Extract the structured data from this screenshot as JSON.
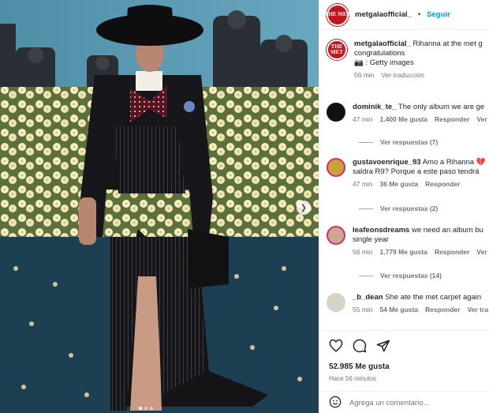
{
  "post": {
    "account": "metgalaofficial_",
    "dot": "•",
    "follow_label": "Seguir",
    "avatar_text": "THE MET"
  },
  "caption": {
    "username": "metgalaofficial_",
    "line1": "Rihanna at the met g",
    "line2": "congratulations",
    "line3": "📷 : Getty images",
    "time": "56 min",
    "translate": "Ver traducción"
  },
  "comments": [
    {
      "username": "dominik_te_",
      "text": "The only album we are ge",
      "line2": "",
      "time": "47 min",
      "likes": "1.400 Me gusta",
      "reply": "Responder",
      "translate": "Ver tr",
      "replies": "Ver respuestas (7)"
    },
    {
      "username": "gustavoenrique_93",
      "text": "Amo a Rihanna 💔",
      "line2": "saldra R9? Porque a este paso tendrá",
      "time": "47 min",
      "likes": "36 Me gusta",
      "reply": "Responder",
      "translate": "",
      "replies": "Ver respuestas (2)"
    },
    {
      "username": "leafeonsdreams",
      "text": "we need an album bu",
      "line2": "single year",
      "time": "56 min",
      "likes": "1.779 Me gusta",
      "reply": "Responder",
      "translate": "Ver tr",
      "replies": "Ver respuestas (14)"
    },
    {
      "username": "_b_dean",
      "text": "She ate the met carpet again",
      "line2": "",
      "time": "55 min",
      "likes": "54 Me gusta",
      "reply": "Responder",
      "translate": "Ver tra",
      "replies": ""
    }
  ],
  "footer": {
    "likes": "52.985 Me gusta",
    "time": "Hace 56 minutos",
    "comment_placeholder": "Agrega un comentario..."
  },
  "icons": [
    "heart-icon",
    "comment-icon",
    "share-icon",
    "emoji-icon",
    "chevron-right-icon"
  ],
  "colors": {
    "accent": "#0095f6",
    "met_red": "#c3161c",
    "carpet": "#1d3f52"
  }
}
